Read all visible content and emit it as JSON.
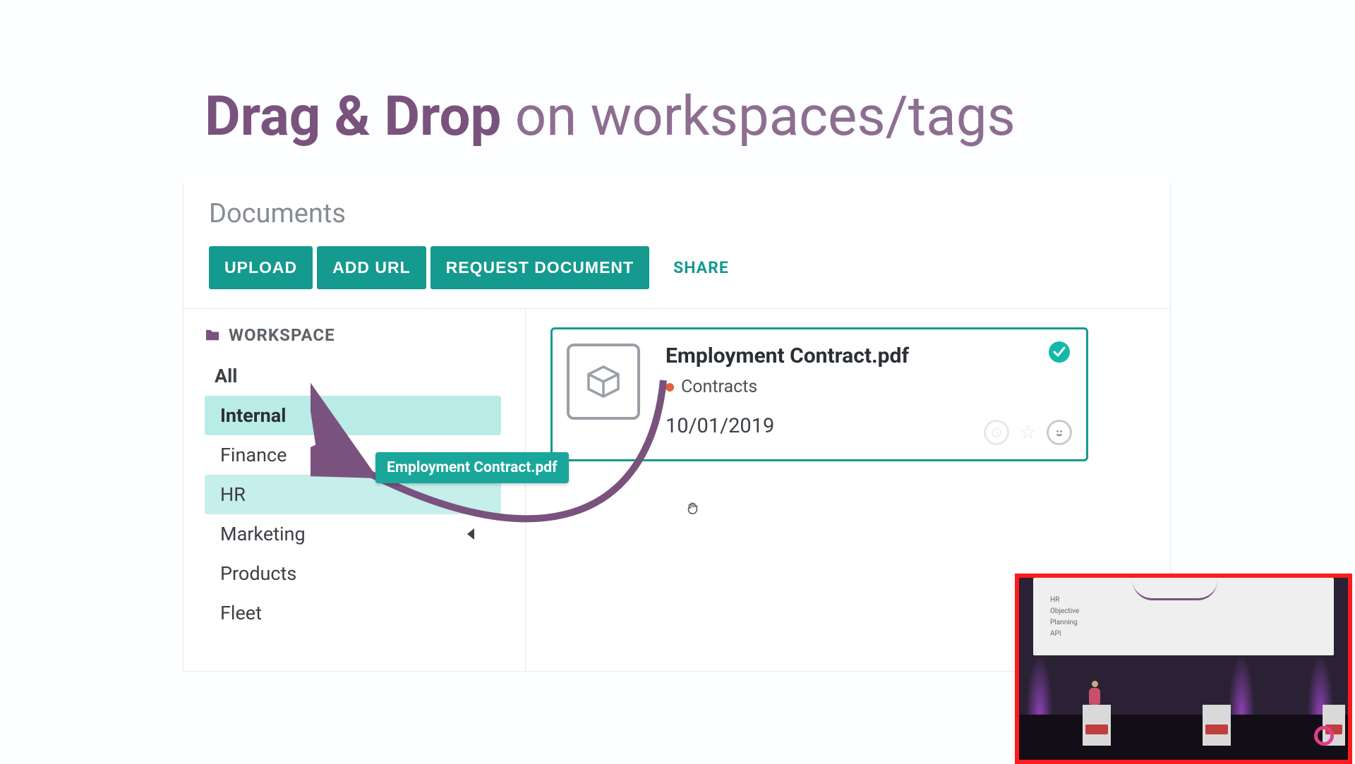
{
  "slide": {
    "title_bold": "Drag & Drop",
    "title_rest": " on workspaces/tags"
  },
  "section_heading": "Documents",
  "toolbar": {
    "upload_label": "UPLOAD",
    "add_url_label": "ADD URL",
    "request_doc_label": "REQUEST DOCUMENT",
    "share_label": "SHARE"
  },
  "sidebar": {
    "header": "WORKSPACE",
    "items": [
      {
        "label": "All"
      },
      {
        "label": "Internal"
      },
      {
        "label": "Finance"
      },
      {
        "label": "HR"
      },
      {
        "label": "Marketing"
      },
      {
        "label": "Products"
      },
      {
        "label": "Fleet"
      }
    ]
  },
  "doc_card": {
    "title": "Employment Contract.pdf",
    "tag": "Contracts",
    "date": "10/01/2019"
  },
  "drag_chip": {
    "label": "Employment Contract.pdf"
  },
  "pip": {
    "lines": [
      "HR",
      "Objective",
      "Planning",
      "API"
    ]
  },
  "colors": {
    "accent": "#159a8f",
    "brand_purple": "#7a527e",
    "tag_dot": "#e2603f"
  }
}
